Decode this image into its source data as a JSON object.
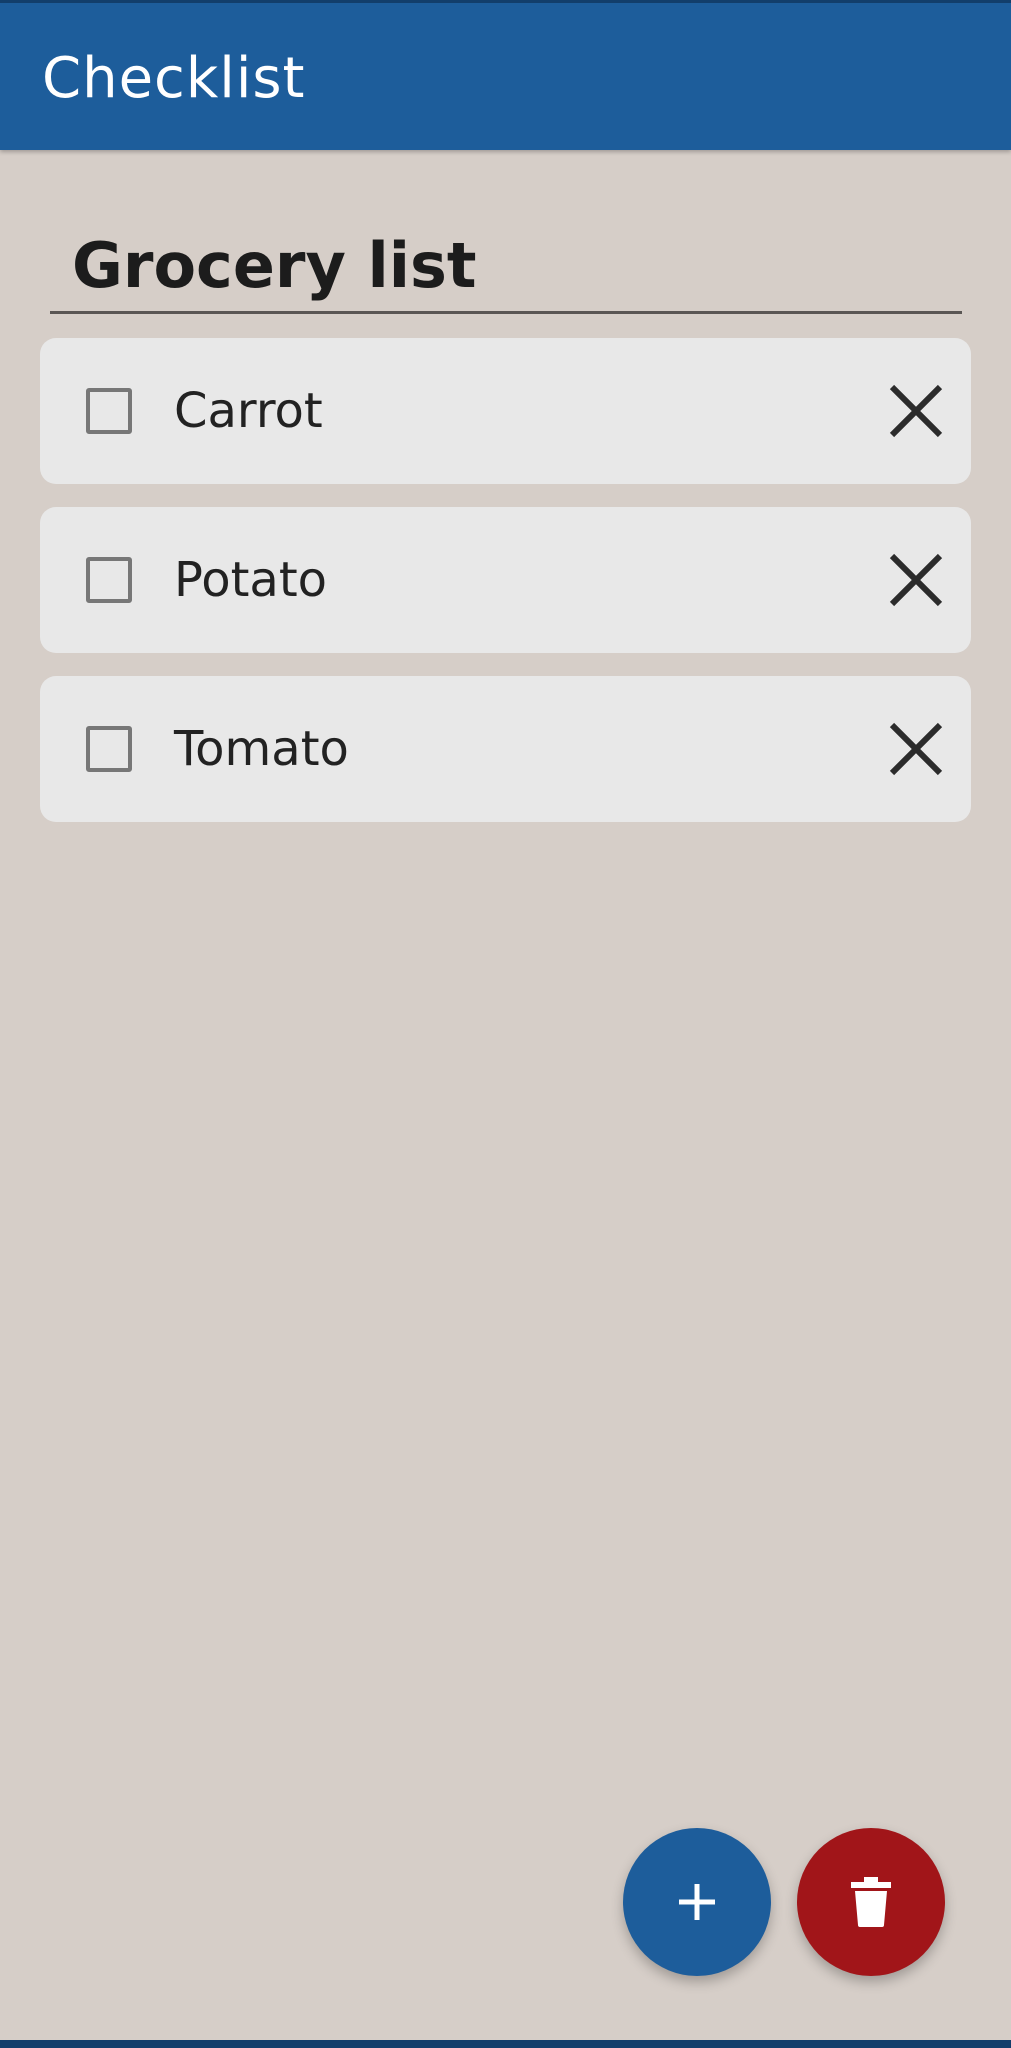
{
  "app_bar": {
    "title": "Checklist"
  },
  "list": {
    "title": "Grocery list",
    "items": [
      {
        "label": "Carrot",
        "checked": false
      },
      {
        "label": "Potato",
        "checked": false
      },
      {
        "label": "Tomato",
        "checked": false
      }
    ]
  },
  "actions": {
    "add_icon": "plus-icon",
    "delete_icon": "trash-icon"
  },
  "colors": {
    "primary": "#1d5d9b",
    "danger": "#a11519",
    "background": "#d6cec8",
    "card": "#e8e8e8"
  }
}
